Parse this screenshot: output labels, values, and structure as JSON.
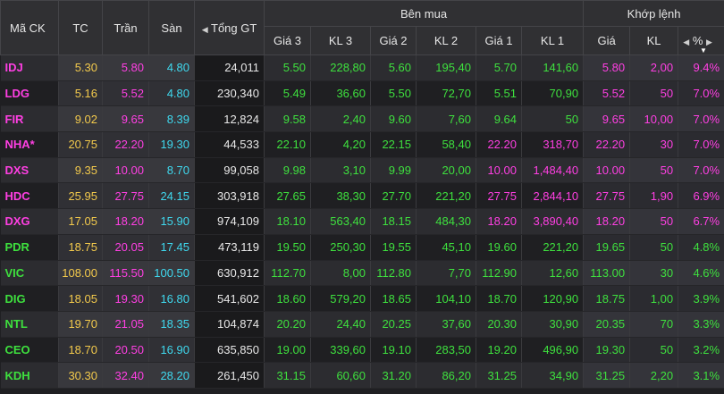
{
  "headers": {
    "symbol": "Mã CK",
    "ref": "TC",
    "ceil": "Trần",
    "floor": "Sàn",
    "total": "Tổng GT",
    "buy_group": "Bên mua",
    "match_group": "Khớp lệnh",
    "buy_cols": [
      "Giá 3",
      "KL 3",
      "Giá 2",
      "KL 2",
      "Giá 1",
      "KL 1"
    ],
    "match_price": "Giá",
    "match_vol": "KL",
    "percent": "%"
  },
  "icons": {
    "left_arrow": "left-arrow-icon",
    "right_arrow": "right-arrow-icon",
    "sort_desc": "sort-desc-icon"
  },
  "colors": {
    "ceiling": "#ff3fe3",
    "floor": "#3fd8ee",
    "reference": "#f2c94c",
    "up": "#3ee03e",
    "neutral": "#e8e8e8"
  },
  "rows": [
    {
      "sym": "IDJ",
      "sc": "ceil",
      "tc": "5.30",
      "tr": "5.80",
      "sn": "4.80",
      "tot": "24,011",
      "p3": "5.50",
      "p3c": "up",
      "v3": "228,80",
      "v3c": "up",
      "p2": "5.60",
      "p2c": "up",
      "v2": "195,40",
      "v2c": "up",
      "p1": "5.70",
      "p1c": "up",
      "v1": "141,60",
      "v1c": "up",
      "kg": "5.80",
      "kgc": "ceil",
      "kv": "2,00",
      "kvc": "ceil",
      "pct": "9.4%",
      "pctc": "ceil"
    },
    {
      "sym": "LDG",
      "sc": "ceil",
      "tc": "5.16",
      "tr": "5.52",
      "sn": "4.80",
      "tot": "230,340",
      "p3": "5.49",
      "p3c": "up",
      "v3": "36,60",
      "v3c": "up",
      "p2": "5.50",
      "p2c": "up",
      "v2": "72,70",
      "v2c": "up",
      "p1": "5.51",
      "p1c": "up",
      "v1": "70,90",
      "v1c": "up",
      "kg": "5.52",
      "kgc": "ceil",
      "kv": "50",
      "kvc": "ceil",
      "pct": "7.0%",
      "pctc": "ceil"
    },
    {
      "sym": "FIR",
      "sc": "ceil",
      "tc": "9.02",
      "tr": "9.65",
      "sn": "8.39",
      "tot": "12,824",
      "p3": "9.58",
      "p3c": "up",
      "v3": "2,40",
      "v3c": "up",
      "p2": "9.60",
      "p2c": "up",
      "v2": "7,60",
      "v2c": "up",
      "p1": "9.64",
      "p1c": "up",
      "v1": "50",
      "v1c": "up",
      "kg": "9.65",
      "kgc": "ceil",
      "kv": "10,00",
      "kvc": "ceil",
      "pct": "7.0%",
      "pctc": "ceil"
    },
    {
      "sym": "NHA*",
      "sc": "ceil",
      "tc": "20.75",
      "tr": "22.20",
      "sn": "19.30",
      "tot": "44,533",
      "p3": "22.10",
      "p3c": "up",
      "v3": "4,20",
      "v3c": "up",
      "p2": "22.15",
      "p2c": "up",
      "v2": "58,40",
      "v2c": "up",
      "p1": "22.20",
      "p1c": "ceil",
      "v1": "318,70",
      "v1c": "ceil",
      "kg": "22.20",
      "kgc": "ceil",
      "kv": "30",
      "kvc": "ceil",
      "pct": "7.0%",
      "pctc": "ceil"
    },
    {
      "sym": "DXS",
      "sc": "ceil",
      "tc": "9.35",
      "tr": "10.00",
      "sn": "8.70",
      "tot": "99,058",
      "p3": "9.98",
      "p3c": "up",
      "v3": "3,10",
      "v3c": "up",
      "p2": "9.99",
      "p2c": "up",
      "v2": "20,00",
      "v2c": "up",
      "p1": "10.00",
      "p1c": "ceil",
      "v1": "1,484,40",
      "v1c": "ceil",
      "kg": "10.00",
      "kgc": "ceil",
      "kv": "50",
      "kvc": "ceil",
      "pct": "7.0%",
      "pctc": "ceil"
    },
    {
      "sym": "HDC",
      "sc": "ceil",
      "tc": "25.95",
      "tr": "27.75",
      "sn": "24.15",
      "tot": "303,918",
      "p3": "27.65",
      "p3c": "up",
      "v3": "38,30",
      "v3c": "up",
      "p2": "27.70",
      "p2c": "up",
      "v2": "221,20",
      "v2c": "up",
      "p1": "27.75",
      "p1c": "ceil",
      "v1": "2,844,10",
      "v1c": "ceil",
      "kg": "27.75",
      "kgc": "ceil",
      "kv": "1,90",
      "kvc": "ceil",
      "pct": "6.9%",
      "pctc": "ceil"
    },
    {
      "sym": "DXG",
      "sc": "ceil",
      "tc": "17.05",
      "tr": "18.20",
      "sn": "15.90",
      "tot": "974,109",
      "p3": "18.10",
      "p3c": "up",
      "v3": "563,40",
      "v3c": "up",
      "p2": "18.15",
      "p2c": "up",
      "v2": "484,30",
      "v2c": "up",
      "p1": "18.20",
      "p1c": "ceil",
      "v1": "3,890,40",
      "v1c": "ceil",
      "kg": "18.20",
      "kgc": "ceil",
      "kv": "50",
      "kvc": "ceil",
      "pct": "6.7%",
      "pctc": "ceil"
    },
    {
      "sym": "PDR",
      "sc": "up",
      "tc": "18.75",
      "tr": "20.05",
      "sn": "17.45",
      "tot": "473,119",
      "p3": "19.50",
      "p3c": "up",
      "v3": "250,30",
      "v3c": "up",
      "p2": "19.55",
      "p2c": "up",
      "v2": "45,10",
      "v2c": "up",
      "p1": "19.60",
      "p1c": "up",
      "v1": "221,20",
      "v1c": "up",
      "kg": "19.65",
      "kgc": "up",
      "kv": "50",
      "kvc": "up",
      "pct": "4.8%",
      "pctc": "up"
    },
    {
      "sym": "VIC",
      "sc": "up",
      "tc": "108.00",
      "tr": "115.50",
      "sn": "100.50",
      "tot": "630,912",
      "p3": "112.70",
      "p3c": "up",
      "v3": "8,00",
      "v3c": "up",
      "p2": "112.80",
      "p2c": "up",
      "v2": "7,70",
      "v2c": "up",
      "p1": "112.90",
      "p1c": "up",
      "v1": "12,60",
      "v1c": "up",
      "kg": "113.00",
      "kgc": "up",
      "kv": "30",
      "kvc": "up",
      "pct": "4.6%",
      "pctc": "up"
    },
    {
      "sym": "DIG",
      "sc": "up",
      "tc": "18.05",
      "tr": "19.30",
      "sn": "16.80",
      "tot": "541,602",
      "p3": "18.60",
      "p3c": "up",
      "v3": "579,20",
      "v3c": "up",
      "p2": "18.65",
      "p2c": "up",
      "v2": "104,10",
      "v2c": "up",
      "p1": "18.70",
      "p1c": "up",
      "v1": "120,90",
      "v1c": "up",
      "kg": "18.75",
      "kgc": "up",
      "kv": "1,00",
      "kvc": "up",
      "pct": "3.9%",
      "pctc": "up"
    },
    {
      "sym": "NTL",
      "sc": "up",
      "tc": "19.70",
      "tr": "21.05",
      "sn": "18.35",
      "tot": "104,874",
      "p3": "20.20",
      "p3c": "up",
      "v3": "24,40",
      "v3c": "up",
      "p2": "20.25",
      "p2c": "up",
      "v2": "37,60",
      "v2c": "up",
      "p1": "20.30",
      "p1c": "up",
      "v1": "30,90",
      "v1c": "up",
      "kg": "20.35",
      "kgc": "up",
      "kv": "70",
      "kvc": "up",
      "pct": "3.3%",
      "pctc": "up"
    },
    {
      "sym": "CEO",
      "sc": "up",
      "tc": "18.70",
      "tr": "20.50",
      "sn": "16.90",
      "tot": "635,850",
      "p3": "19.00",
      "p3c": "up",
      "v3": "339,60",
      "v3c": "up",
      "p2": "19.10",
      "p2c": "up",
      "v2": "283,50",
      "v2c": "up",
      "p1": "19.20",
      "p1c": "up",
      "v1": "496,90",
      "v1c": "up",
      "kg": "19.30",
      "kgc": "up",
      "kv": "50",
      "kvc": "up",
      "pct": "3.2%",
      "pctc": "up"
    },
    {
      "sym": "KDH",
      "sc": "up",
      "tc": "30.30",
      "tr": "32.40",
      "sn": "28.20",
      "tot": "261,450",
      "p3": "31.15",
      "p3c": "up",
      "v3": "60,60",
      "v3c": "up",
      "p2": "31.20",
      "p2c": "up",
      "v2": "86,20",
      "v2c": "up",
      "p1": "31.25",
      "p1c": "up",
      "v1": "34,90",
      "v1c": "up",
      "kg": "31.25",
      "kgc": "up",
      "kv": "2,20",
      "kvc": "up",
      "pct": "3.1%",
      "pctc": "up"
    }
  ]
}
